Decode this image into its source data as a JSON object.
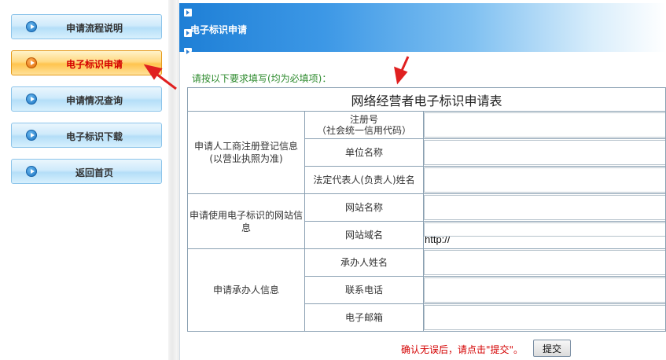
{
  "sidebar": {
    "items": [
      {
        "label": "申请流程说明",
        "active": false
      },
      {
        "label": "电子标识申请",
        "active": true
      },
      {
        "label": "申请情况查询",
        "active": false
      },
      {
        "label": "电子标识下载",
        "active": false
      },
      {
        "label": "返回首页",
        "active": false
      }
    ]
  },
  "header": {
    "title": "电子标识申请"
  },
  "instruction": "请按以下要求填写(均为必填项)：",
  "form": {
    "title": "网络经营者电子标识申请表",
    "groups": {
      "registration": "申请人工商注册登记信息(以营业执照为准)",
      "website": "申请使用电子标识的网站信息",
      "agent": "申请承办人信息"
    },
    "fields": {
      "reg_no_line1": "注册号",
      "reg_no_line2": "（社会统一信用代码）",
      "company_name": "单位名称",
      "legal_rep": "法定代表人(负责人)姓名",
      "site_name": "网站名称",
      "site_domain": "网站域名",
      "agent_name": "承办人姓名",
      "phone": "联系电话",
      "email": "电子邮箱"
    },
    "domain_prefix": "http://"
  },
  "confirm_text": "确认无误后，请点击\"提交\"。",
  "submit_label": "提交",
  "colors": {
    "annotation_arrow": "#e02020",
    "active_label": "#d40000",
    "instruction": "#2e8b2e",
    "header_blue": "#1e7fd6"
  }
}
